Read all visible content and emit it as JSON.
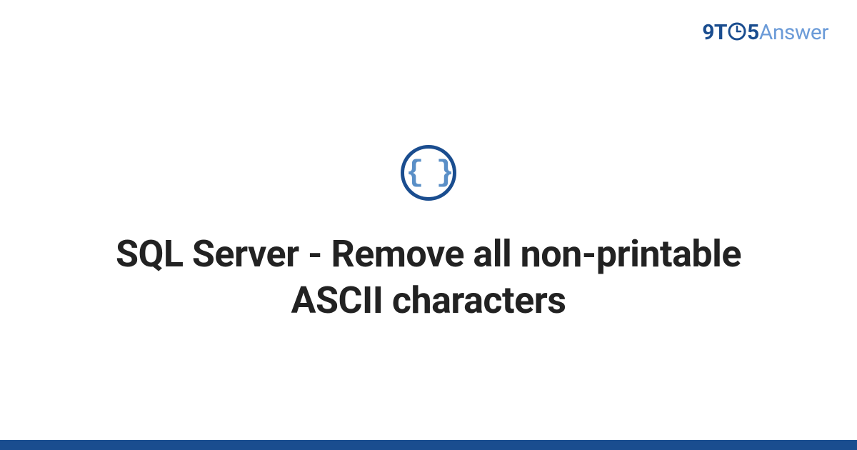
{
  "brand": {
    "part_9t": "9T",
    "part_5": "5",
    "part_answer": "Answer"
  },
  "icon": {
    "name": "code-braces-icon",
    "glyph": "{ }"
  },
  "title": "SQL Server - Remove all non-printable ASCII characters",
  "colors": {
    "accent_dark": "#1a4d8f",
    "accent_light": "#6b9bd8",
    "icon_inner": "#5a8fc7",
    "text_main": "#222222",
    "background": "#ffffff"
  }
}
